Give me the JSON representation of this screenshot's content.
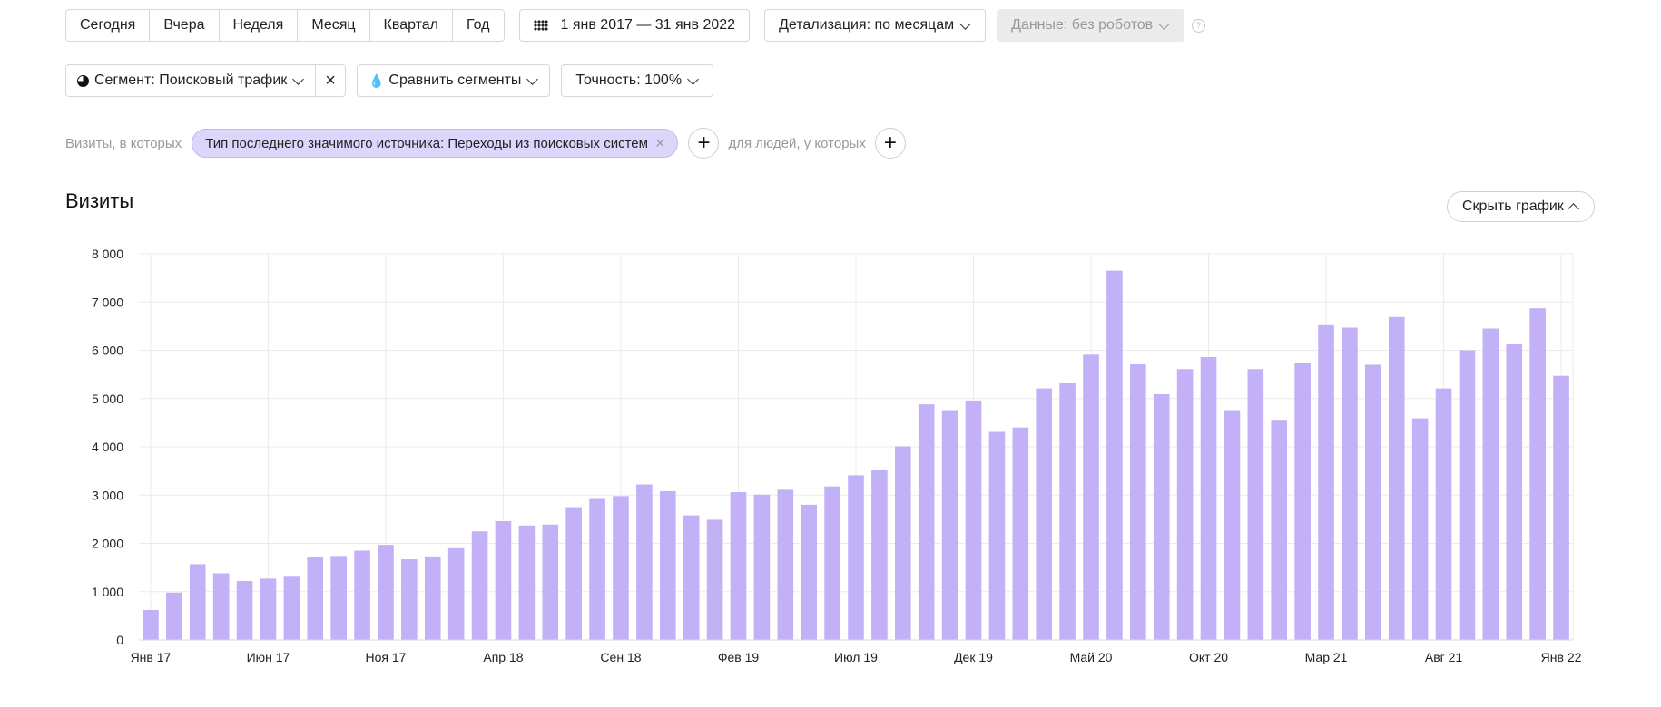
{
  "period_buttons": [
    "Сегодня",
    "Вчера",
    "Неделя",
    "Месяц",
    "Квартал",
    "Год"
  ],
  "date_range": {
    "label": "1 янв 2017 — 31 янв 2022",
    "icon": "calendar-grid-icon"
  },
  "detail": {
    "label": "Детализация: по месяцам"
  },
  "data_filter": {
    "label": "Данные: без роботов",
    "help": "?"
  },
  "segment": {
    "label": "Сегмент: Поисковый трафик",
    "remove_icon": "×"
  },
  "compare": {
    "label": "Сравнить сегменты"
  },
  "accuracy": {
    "label": "Точность: 100%"
  },
  "conditions": {
    "visits_label": "Визиты, в которых",
    "chip": "Тип последнего значимого источника: Переходы из поисковых систем",
    "chip_remove": "×",
    "add": "+",
    "people_label": "для людей, у которых"
  },
  "chart_title": "Визиты",
  "hide_chart": "Скрыть график",
  "colors": {
    "bar": "#c2b1f7",
    "grid": "#ebebeb",
    "chip_bg": "#dcd6fb"
  },
  "chart_data": {
    "type": "bar",
    "x_ticks": [
      {
        "index": 0,
        "label": "Янв 17"
      },
      {
        "index": 5,
        "label": "Июн 17"
      },
      {
        "index": 10,
        "label": "Ноя 17"
      },
      {
        "index": 15,
        "label": "Апр 18"
      },
      {
        "index": 20,
        "label": "Сен 18"
      },
      {
        "index": 25,
        "label": "Фев 19"
      },
      {
        "index": 30,
        "label": "Июл 19"
      },
      {
        "index": 35,
        "label": "Дек 19"
      },
      {
        "index": 40,
        "label": "Май 20"
      },
      {
        "index": 45,
        "label": "Окт 20"
      },
      {
        "index": 50,
        "label": "Мар 21"
      },
      {
        "index": 55,
        "label": "Авг 21"
      },
      {
        "index": 60,
        "label": "Янв 22"
      }
    ],
    "y_ticks": [
      "0",
      "1 000",
      "2 000",
      "3 000",
      "4 000",
      "5 000",
      "6 000",
      "7 000",
      "8 000"
    ],
    "ylim": [
      0,
      8000
    ],
    "values": [
      620,
      980,
      1570,
      1380,
      1220,
      1270,
      1310,
      1710,
      1740,
      1850,
      1970,
      1670,
      1730,
      1900,
      2250,
      2460,
      2370,
      2390,
      2750,
      2940,
      2980,
      3220,
      3080,
      2580,
      2490,
      3060,
      3010,
      3110,
      2800,
      3180,
      3410,
      3530,
      4010,
      4880,
      4760,
      4960,
      4310,
      4400,
      5210,
      5320,
      5910,
      7650,
      5710,
      5090,
      5610,
      5860,
      4760,
      5610,
      4560,
      5730,
      6520,
      6470,
      5700,
      6690,
      4590,
      5210,
      6000,
      6450,
      6130,
      6870,
      5470
    ],
    "grid": true
  }
}
